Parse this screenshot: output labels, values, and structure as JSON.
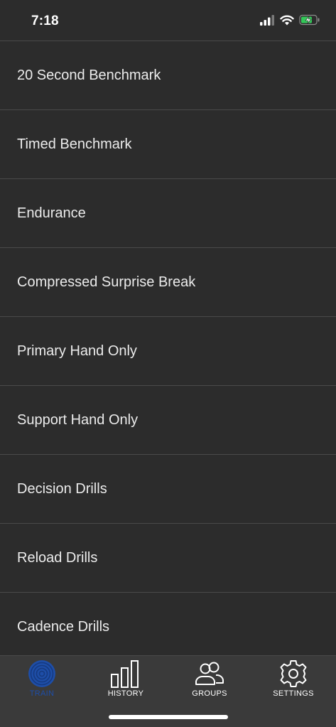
{
  "status_bar": {
    "time": "7:18",
    "icons": [
      "signal-icon",
      "wifi-icon",
      "battery-charging-icon"
    ],
    "battery_color": "#34c759"
  },
  "menu": {
    "items": [
      {
        "label": "20 Second Benchmark"
      },
      {
        "label": "Timed Benchmark"
      },
      {
        "label": "Endurance"
      },
      {
        "label": "Compressed Surprise Break"
      },
      {
        "label": "Primary Hand Only"
      },
      {
        "label": "Support Hand Only"
      },
      {
        "label": "Decision Drills"
      },
      {
        "label": "Reload Drills"
      },
      {
        "label": "Cadence Drills"
      }
    ]
  },
  "tab_bar": {
    "active_color": "#1e4ea8",
    "tabs": [
      {
        "label": "TRAIN",
        "icon": "target-icon",
        "active": true
      },
      {
        "label": "HISTORY",
        "icon": "bar-chart-icon",
        "active": false
      },
      {
        "label": "GROUPS",
        "icon": "users-icon",
        "active": false
      },
      {
        "label": "SETTINGS",
        "icon": "gear-icon",
        "active": false
      }
    ]
  }
}
